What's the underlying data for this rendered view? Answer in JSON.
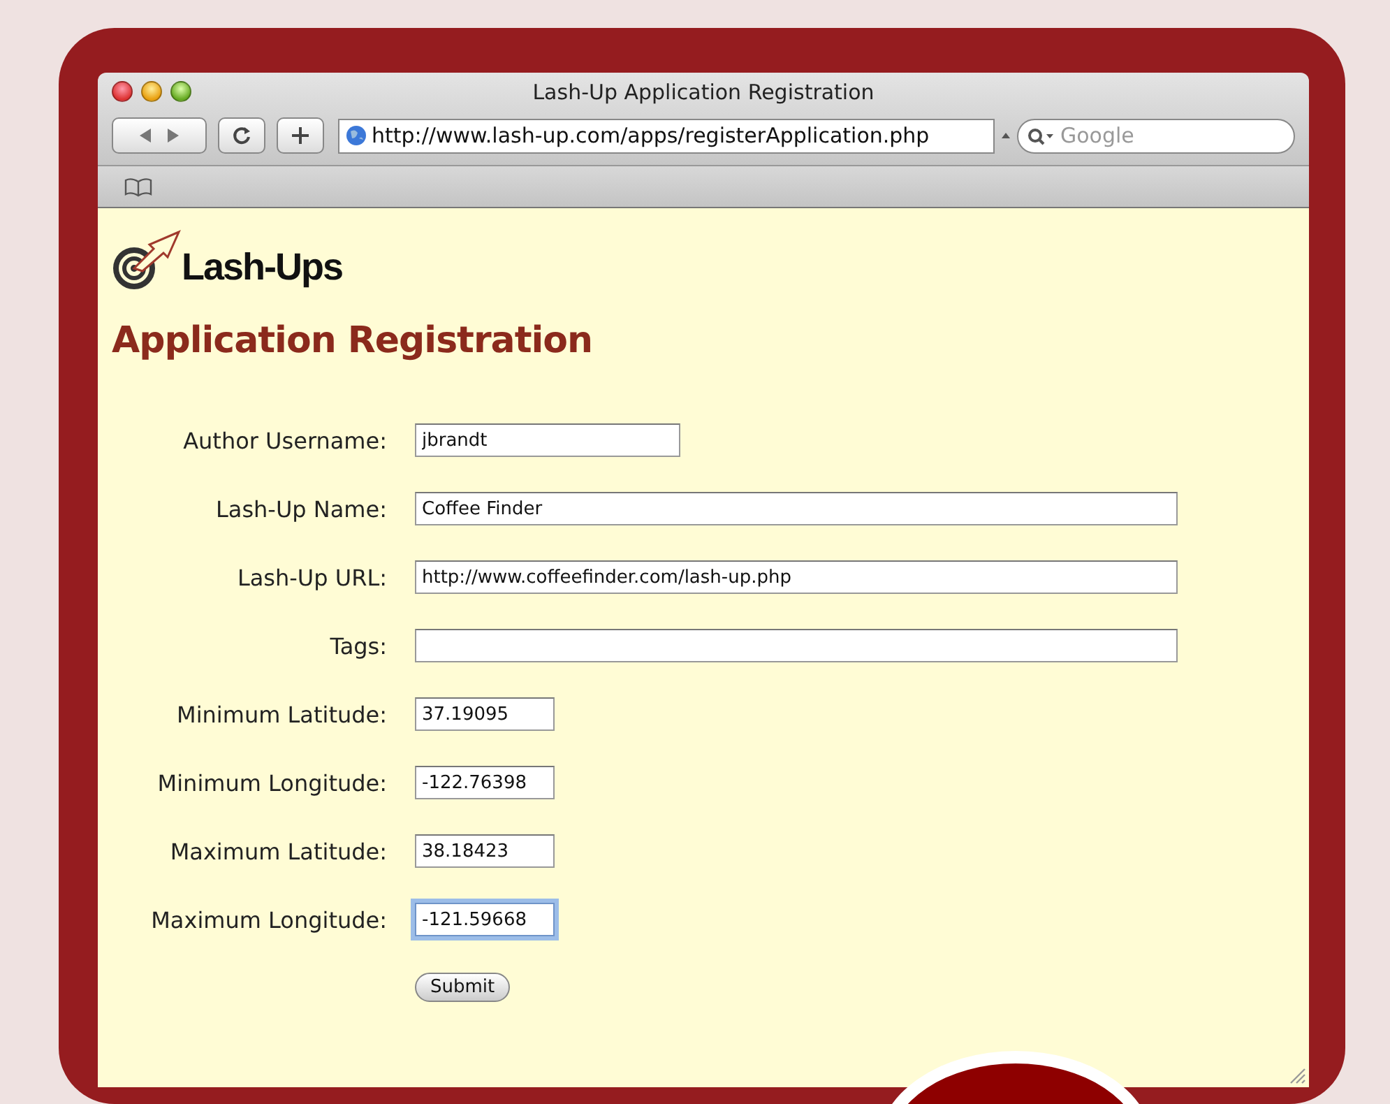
{
  "window": {
    "title": "Lash-Up Application Registration"
  },
  "toolbar": {
    "url": "http://www.lash-up.com/apps/registerApplication.php",
    "search": {
      "placeholder": "Google"
    }
  },
  "page": {
    "logo": "Lash-Ups",
    "heading": "Application Registration",
    "fields": [
      {
        "label": "Author Username:",
        "value": "jbrandt",
        "kind": "medium",
        "focused": false
      },
      {
        "label": "Lash-Up Name:",
        "value": "Coffee Finder",
        "kind": "wide",
        "focused": false
      },
      {
        "label": "Lash-Up URL:",
        "value": "http://www.coffeefinder.com/lash-up.php",
        "kind": "wide",
        "focused": false
      },
      {
        "label": "Tags:",
        "kind": "wide",
        "focused": false
      },
      {
        "label": "Minimum Latitude:",
        "value": "37.19095",
        "kind": "small",
        "focused": false
      },
      {
        "label": "Minimum Longitude:",
        "value": "-122.76398",
        "kind": "small",
        "focused": false
      },
      {
        "label": "Maximum Latitude:",
        "value": "38.18423",
        "kind": "small",
        "focused": false
      },
      {
        "label": "Maximum Longitude:",
        "value": "-121.59668",
        "kind": "small",
        "focused": true
      }
    ],
    "submit": "Submit"
  }
}
